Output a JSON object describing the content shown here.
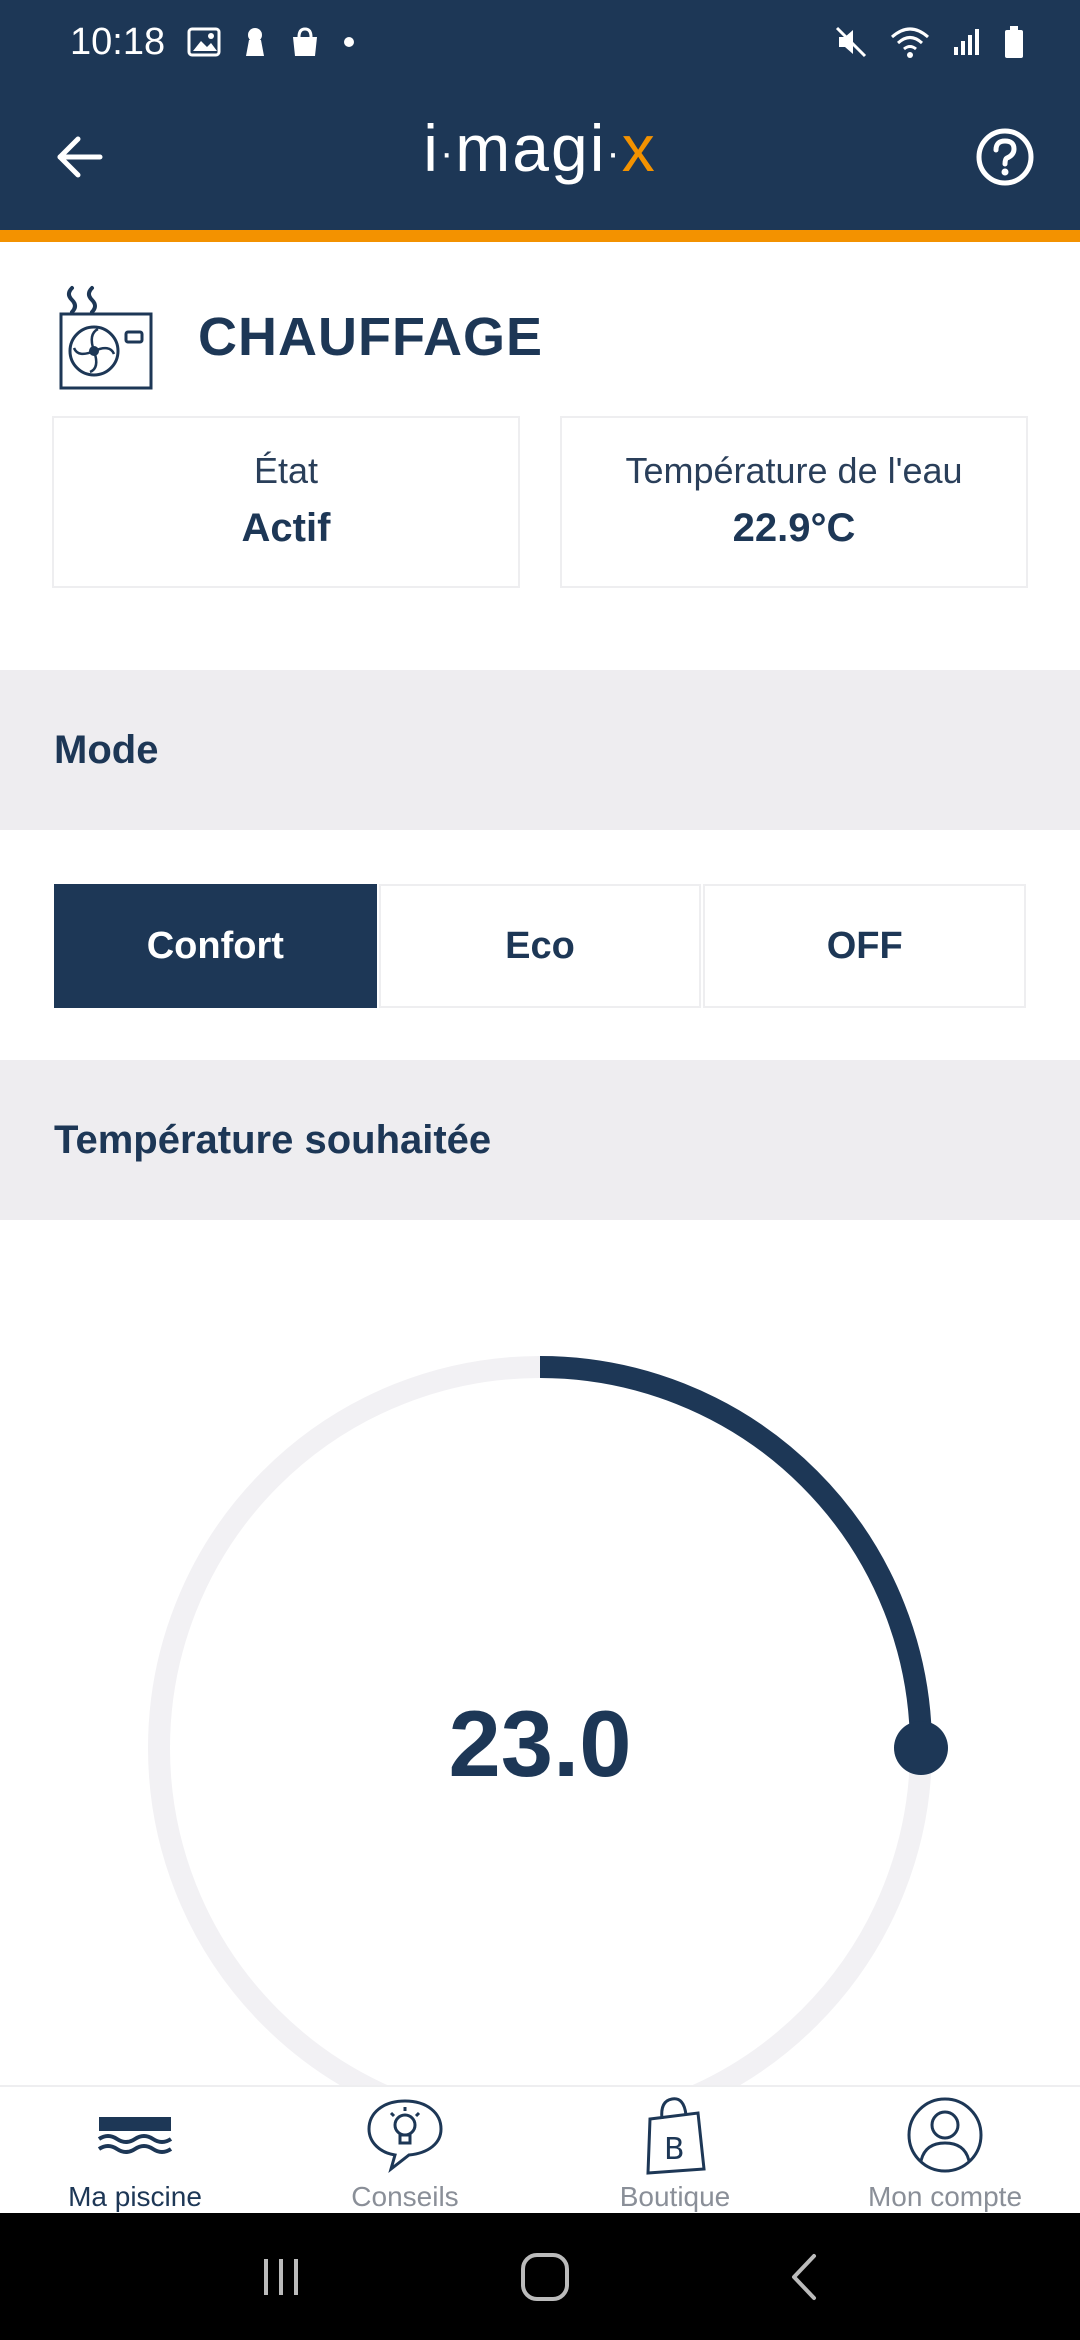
{
  "status_bar": {
    "time": "10:18"
  },
  "header": {
    "logo_i": "i",
    "logo_dot": "·",
    "logo_magi": "magi",
    "logo_x": "x"
  },
  "device": {
    "title": "CHAUFFAGE",
    "state_label": "État",
    "state_value": "Actif",
    "water_temp_label": "Température de l'eau",
    "water_temp_value": "22.9°C"
  },
  "mode": {
    "title": "Mode",
    "options": [
      "Confort",
      "Eco",
      "OFF"
    ],
    "selected": "Confort"
  },
  "target_temp": {
    "title": "Température souhaitée",
    "value": "23.0",
    "dial_fraction": 0.25
  },
  "bottom_nav": {
    "items": [
      {
        "label": "Ma piscine",
        "icon": "pool-icon"
      },
      {
        "label": "Conseils",
        "icon": "lightbulb-chat-icon"
      },
      {
        "label": "Boutique",
        "icon": "shopping-bag-icon"
      },
      {
        "label": "Mon compte",
        "icon": "user-account-icon"
      }
    ],
    "active_index": 0
  },
  "colors": {
    "primary": "#1d3756",
    "accent": "#f39200",
    "section_bg": "#eeedf0",
    "dial_track": "#f2f1f4"
  }
}
